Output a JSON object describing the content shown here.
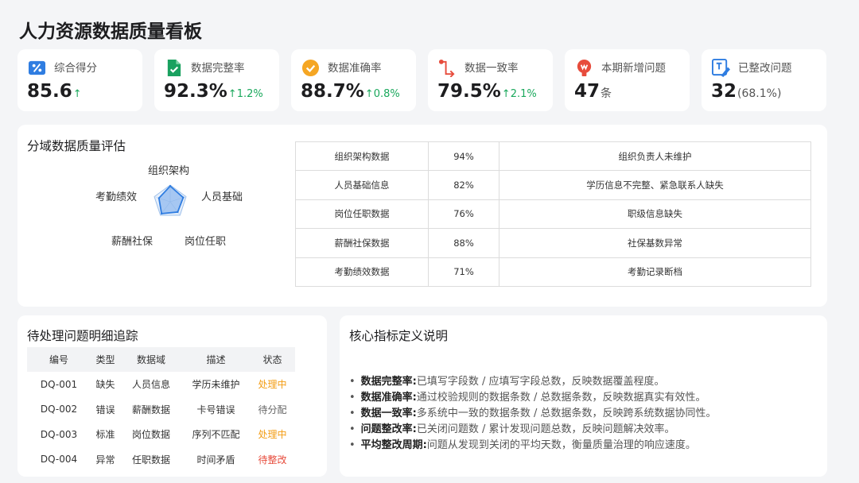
{
  "page": {
    "title": "人力资源数据质量看板"
  },
  "kpis": [
    {
      "label": "综合得分",
      "value": "85.6",
      "delta": "↑",
      "unit": "",
      "icon": "score-card-icon",
      "color": "#2f7de1"
    },
    {
      "label": "数据完整率",
      "value": "92.3%",
      "delta": "↑1.2%",
      "unit": "",
      "icon": "document-check-icon",
      "color": "#19a15f"
    },
    {
      "label": "数据准确率",
      "value": "88.7%",
      "delta": "↑0.8%",
      "unit": "",
      "icon": "check-circle-icon",
      "color": "#f5a623"
    },
    {
      "label": "数据一致率",
      "value": "79.5%",
      "delta": "↑2.1%",
      "unit": "",
      "icon": "flow-path-icon",
      "color": "#e74c3c"
    },
    {
      "label": "本期新增问题",
      "value": "47",
      "delta": "",
      "unit": "条",
      "icon": "alert-bulb-icon",
      "color": "#e74c3c"
    },
    {
      "label": "已整改问题",
      "value": "32",
      "delta": "",
      "unit": "(68.1%)",
      "icon": "edit-doc-icon",
      "color": "#2f7de1"
    }
  ],
  "domain_section": {
    "title": "分域数据质量评估",
    "radar_axes": [
      "组织架构",
      "人员基础",
      "岗位任职",
      "薪酬社保",
      "考勤绩效"
    ],
    "rows": [
      {
        "domain": "组织架构数据",
        "score": "94%",
        "issue": "组织负责人未维护"
      },
      {
        "domain": "人员基础信息",
        "score": "82%",
        "issue": "学历信息不完整、紧急联系人缺失"
      },
      {
        "domain": "岗位任职数据",
        "score": "76%",
        "issue": "职级信息缺失"
      },
      {
        "domain": "薪酬社保数据",
        "score": "88%",
        "issue": "社保基数异常"
      },
      {
        "domain": "考勤绩效数据",
        "score": "71%",
        "issue": "考勤记录断档"
      }
    ]
  },
  "chart_data": {
    "type": "radar",
    "categories": [
      "组织架构",
      "人员基础",
      "岗位任职",
      "薪酬社保",
      "考勤绩效"
    ],
    "values": [
      94,
      82,
      76,
      88,
      71
    ],
    "max": 100
  },
  "issues_section": {
    "title": "待处理问题明细追踪",
    "headers": [
      "编号",
      "类型",
      "数据域",
      "描述",
      "状态"
    ],
    "rows": [
      {
        "id": "DQ-001",
        "type": "缺失",
        "domain": "人员信息",
        "desc": "学历未维护",
        "status": "处理中",
        "status_color": "#f39c12"
      },
      {
        "id": "DQ-002",
        "type": "错误",
        "domain": "薪酬数据",
        "desc": "卡号错误",
        "status": "待分配",
        "status_color": "#666666"
      },
      {
        "id": "DQ-003",
        "type": "标准",
        "domain": "岗位数据",
        "desc": "序列不匹配",
        "status": "处理中",
        "status_color": "#f39c12"
      },
      {
        "id": "DQ-004",
        "type": "异常",
        "domain": "任职数据",
        "desc": "时间矛盾",
        "status": "待整改",
        "status_color": "#e74c3c"
      }
    ]
  },
  "defs_section": {
    "title": "核心指标定义说明",
    "items": [
      {
        "term": "数据完整率:",
        "text": "已填写字段数 / 应填写字段总数，反映数据覆盖程度。"
      },
      {
        "term": "数据准确率:",
        "text": "通过校验规则的数据条数 / 总数据条数，反映数据真实有效性。"
      },
      {
        "term": "数据一致率:",
        "text": "多系统中一致的数据条数 / 总数据条数，反映跨系统数据协同性。"
      },
      {
        "term": "问题整改率:",
        "text": "已关闭问题数 / 累计发现问题总数，反映问题解决效率。"
      },
      {
        "term": "平均整改周期:",
        "text": "问题从发现到关闭的平均天数，衡量质量治理的响应速度。"
      }
    ]
  }
}
